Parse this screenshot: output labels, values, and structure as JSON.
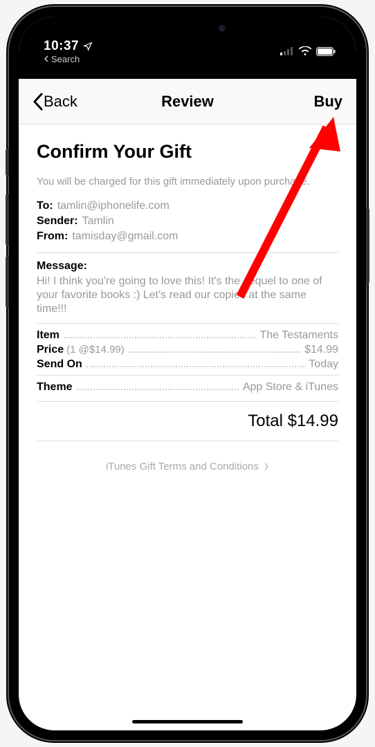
{
  "status": {
    "time": "10:37",
    "breadcrumb": "Search"
  },
  "nav": {
    "back": "Back",
    "title": "Review",
    "action": "Buy"
  },
  "page": {
    "heading": "Confirm Your Gift",
    "subtext": "You will be charged for this gift immediately upon purchase."
  },
  "recipient": {
    "to_label": "To:",
    "to_value": "tamlin@iphonelife.com",
    "sender_label": "Sender:",
    "sender_value": "Tamlin",
    "from_label": "From:",
    "from_value": "tamisday@gmail.com"
  },
  "message": {
    "label": "Message:",
    "text": "Hi! I think you're going to love this! It's the sequel to one of your favorite books :) Let's read our copies at the same time!!!"
  },
  "order": {
    "item_label": "Item",
    "item_value": "The Testaments",
    "price_label": "Price",
    "price_sub": "(1 @$14.99)",
    "price_value": "$14.99",
    "sendon_label": "Send On",
    "sendon_value": "Today",
    "theme_label": "Theme",
    "theme_value": "App Store & iTunes",
    "total_label": "Total",
    "total_value": "$14.99"
  },
  "footer": {
    "terms": "iTunes Gift Terms and Conditions"
  }
}
